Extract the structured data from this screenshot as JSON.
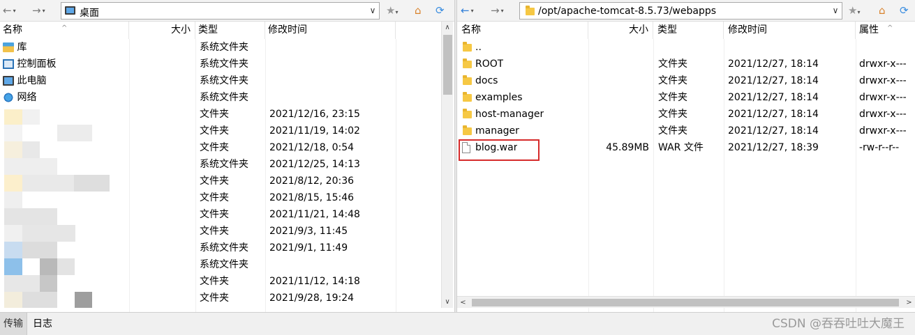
{
  "left": {
    "path": "桌面",
    "columns": {
      "name": "名称",
      "size": "大小",
      "type": "类型",
      "modified": "修改时间"
    },
    "rows": [
      {
        "name": "库",
        "type": "系统文件夹",
        "modified": "",
        "icon": "library-icon"
      },
      {
        "name": "控制面板",
        "type": "系统文件夹",
        "modified": "",
        "icon": "control-panel-icon"
      },
      {
        "name": "此电脑",
        "type": "系统文件夹",
        "modified": "",
        "icon": "computer-icon"
      },
      {
        "name": "网络",
        "type": "系统文件夹",
        "modified": "",
        "icon": "network-icon"
      },
      {
        "name": "",
        "type": "文件夹",
        "modified": "2021/12/16, 23:15"
      },
      {
        "name": "",
        "type": "文件夹",
        "modified": "2021/11/19, 14:02"
      },
      {
        "name": "",
        "type": "文件夹",
        "modified": "2021/12/18, 0:54"
      },
      {
        "name": "",
        "type": "系统文件夹",
        "modified": "2021/12/25, 14:13"
      },
      {
        "name": "",
        "type": "文件夹",
        "modified": "2021/8/12, 20:36"
      },
      {
        "name": "",
        "type": "文件夹",
        "modified": "2021/8/15, 15:46"
      },
      {
        "name": "",
        "type": "文件夹",
        "modified": "2021/11/21, 14:48"
      },
      {
        "name": "",
        "type": "文件夹",
        "modified": "2021/9/3, 11:45"
      },
      {
        "name": "",
        "type": "系统文件夹",
        "modified": "2021/9/1, 11:49"
      },
      {
        "name": "",
        "type": "系统文件夹",
        "modified": ""
      },
      {
        "name": "",
        "type": "文件夹",
        "modified": "2021/11/12, 14:18"
      },
      {
        "name": "",
        "type": "文件夹",
        "modified": "2021/9/28, 19:24"
      }
    ]
  },
  "right": {
    "path": "/opt/apache-tomcat-8.5.73/webapps",
    "columns": {
      "name": "名称",
      "size": "大小",
      "type": "类型",
      "modified": "修改时间",
      "attr": "属性"
    },
    "rows": [
      {
        "name": "..",
        "size": "",
        "type": "",
        "modified": "",
        "attr": "",
        "icon": "folder-icon"
      },
      {
        "name": "ROOT",
        "size": "",
        "type": "文件夹",
        "modified": "2021/12/27, 18:14",
        "attr": "drwxr-x---",
        "icon": "folder-icon"
      },
      {
        "name": "docs",
        "size": "",
        "type": "文件夹",
        "modified": "2021/12/27, 18:14",
        "attr": "drwxr-x---",
        "icon": "folder-icon"
      },
      {
        "name": "examples",
        "size": "",
        "type": "文件夹",
        "modified": "2021/12/27, 18:14",
        "attr": "drwxr-x---",
        "icon": "folder-icon"
      },
      {
        "name": "host-manager",
        "size": "",
        "type": "文件夹",
        "modified": "2021/12/27, 18:14",
        "attr": "drwxr-x---",
        "icon": "folder-icon"
      },
      {
        "name": "manager",
        "size": "",
        "type": "文件夹",
        "modified": "2021/12/27, 18:14",
        "attr": "drwxr-x---",
        "icon": "folder-icon"
      },
      {
        "name": "blog.war",
        "size": "45.89MB",
        "type": "WAR 文件",
        "modified": "2021/12/27, 18:39",
        "attr": "-rw-r--r--",
        "icon": "file-icon"
      }
    ]
  },
  "bottom": {
    "tabs": [
      {
        "label": "传输"
      },
      {
        "label": "日志"
      }
    ],
    "watermark": "CSDN @吞吞吐吐大魔王"
  },
  "colors": {
    "highlight": "#d62a2a",
    "accent": "#2f7ed8",
    "folder": "#f6c844"
  }
}
